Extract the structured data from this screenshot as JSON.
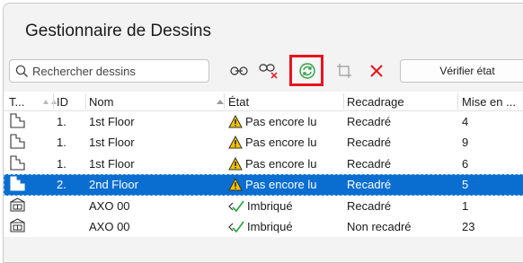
{
  "window": {
    "title": "Gestionnaire de Dessins"
  },
  "toolbar": {
    "search_placeholder": "Rechercher dessins",
    "verify_label": "Vérifier état",
    "icons": [
      "link-icon",
      "unlink-icon",
      "refresh-icon",
      "crop-icon",
      "delete-icon"
    ],
    "accent_red": "#e8141c",
    "refresh_color": "#2ea043"
  },
  "table": {
    "columns": [
      "T...",
      "ID",
      "Nom",
      "État",
      "Recadrage",
      "Mise en ..."
    ],
    "rows": [
      {
        "type": "floor-plan",
        "id": "1.",
        "name": "1st Floor",
        "state": "Pas encore lu",
        "state_icon": "warning-icon",
        "crop": "Recadré",
        "update": "4",
        "selected": false
      },
      {
        "type": "floor-plan",
        "id": "1.",
        "name": "1st Floor",
        "state": "Pas encore lu",
        "state_icon": "warning-icon",
        "crop": "Recadré",
        "update": "9",
        "selected": false
      },
      {
        "type": "floor-plan",
        "id": "1.",
        "name": "1st Floor",
        "state": "Pas encore lu",
        "state_icon": "warning-icon",
        "crop": "Recadré",
        "update": "6",
        "selected": false
      },
      {
        "type": "floor-plan",
        "id": "2.",
        "name": "2nd Floor",
        "state": "Pas encore lu",
        "state_icon": "warning-icon",
        "crop": "Recadré",
        "update": "5",
        "selected": true
      },
      {
        "type": "axonometry",
        "id": "",
        "name": "AXO 00",
        "state": "Imbriqué",
        "state_icon": "embedded-icon",
        "crop": "Recadré",
        "update": "1",
        "selected": false
      },
      {
        "type": "axonometry",
        "id": "",
        "name": "AXO 00",
        "state": "Imbriqué",
        "state_icon": "embedded-icon",
        "crop": "Non recadré",
        "update": "23",
        "selected": false
      }
    ]
  },
  "colors": {
    "selection": "#0a6ed1",
    "warning": "#f2c200",
    "embedded": "#22a33a"
  }
}
